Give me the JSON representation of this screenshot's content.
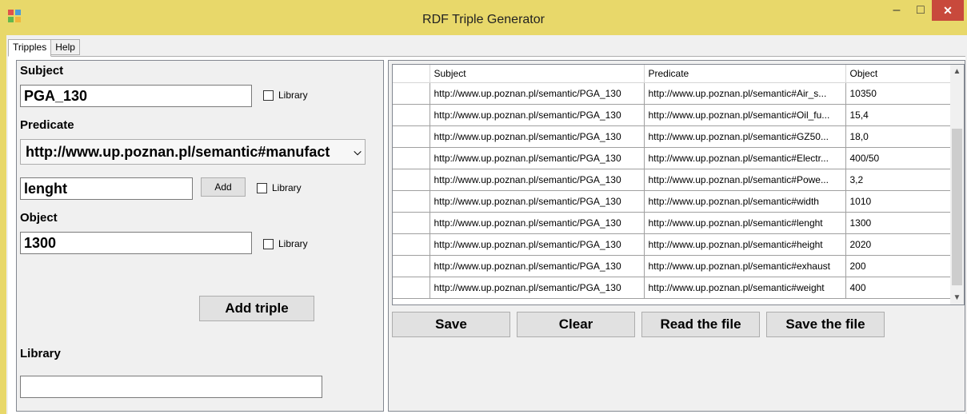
{
  "window": {
    "title": "RDF Triple Generator",
    "minimize": "–",
    "maximize": "□",
    "close": "✕"
  },
  "tabs": [
    {
      "label": "Tripples"
    },
    {
      "label": "Help"
    }
  ],
  "left": {
    "subject_label": "Subject",
    "subject_value": "PGA_130",
    "library_label": "Library",
    "predicate_label": "Predicate",
    "predicate_selected": "http://www.up.poznan.pl/semantic#manufact",
    "predicate_new_value": "lenght",
    "add_label": "Add",
    "object_label": "Object",
    "object_value": "1300",
    "add_triple_label": "Add triple",
    "library_section_label": "Library",
    "library_input_value": ""
  },
  "grid": {
    "columns": [
      "Subject",
      "Predicate",
      "Object"
    ],
    "rows": [
      [
        "http://www.up.poznan.pl/semantic/PGA_130",
        "http://www.up.poznan.pl/semantic#Air_s...",
        "10350"
      ],
      [
        "http://www.up.poznan.pl/semantic/PGA_130",
        "http://www.up.poznan.pl/semantic#Oil_fu...",
        "15,4"
      ],
      [
        "http://www.up.poznan.pl/semantic/PGA_130",
        "http://www.up.poznan.pl/semantic#GZ50...",
        "18,0"
      ],
      [
        "http://www.up.poznan.pl/semantic/PGA_130",
        "http://www.up.poznan.pl/semantic#Electr...",
        "400/50"
      ],
      [
        "http://www.up.poznan.pl/semantic/PGA_130",
        "http://www.up.poznan.pl/semantic#Powe...",
        "3,2"
      ],
      [
        "http://www.up.poznan.pl/semantic/PGA_130",
        "http://www.up.poznan.pl/semantic#width",
        "1010"
      ],
      [
        "http://www.up.poznan.pl/semantic/PGA_130",
        "http://www.up.poznan.pl/semantic#lenght",
        "1300"
      ],
      [
        "http://www.up.poznan.pl/semantic/PGA_130",
        "http://www.up.poznan.pl/semantic#height",
        "2020"
      ],
      [
        "http://www.up.poznan.pl/semantic/PGA_130",
        "http://www.up.poznan.pl/semantic#exhaust",
        "200"
      ],
      [
        "http://www.up.poznan.pl/semantic/PGA_130",
        "http://www.up.poznan.pl/semantic#weight",
        "400"
      ]
    ]
  },
  "buttons": {
    "save": "Save",
    "clear": "Clear",
    "read_file": "Read the file",
    "save_file": "Save the file"
  },
  "colors": {
    "titlebar": "#e8d86a",
    "close": "#c8493c",
    "panel": "#f0f0f0"
  }
}
